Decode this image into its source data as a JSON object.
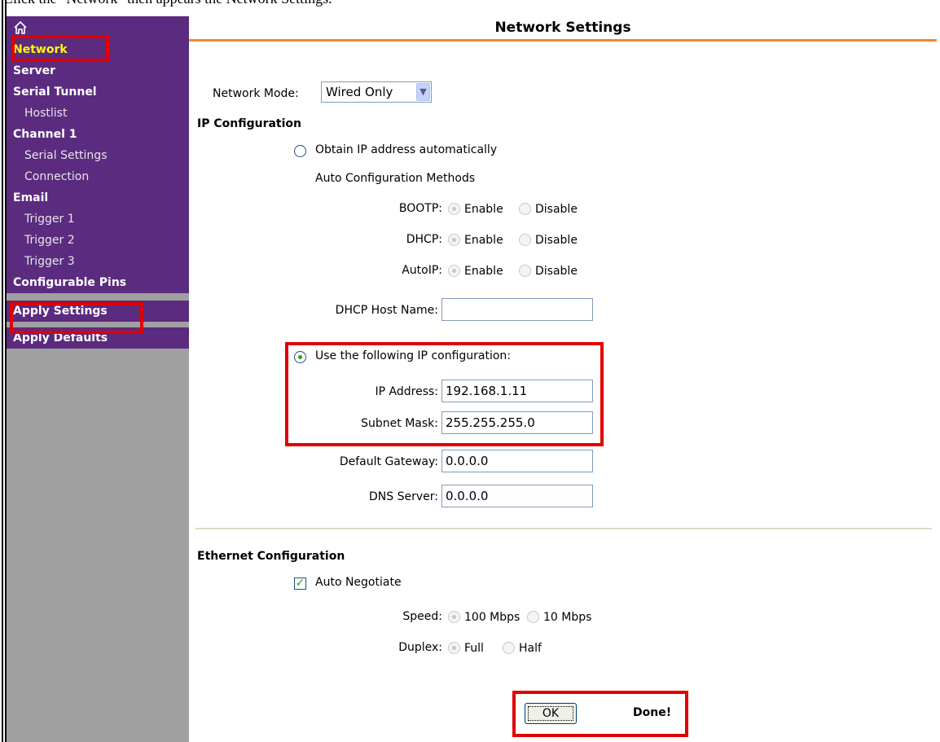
{
  "caption": "Click the \"Network\" then appears the Network Settings.",
  "sidebar": {
    "home_icon": "home-icon",
    "items": {
      "network": "Network",
      "server": "Server",
      "serial_tunnel": "Serial Tunnel",
      "hostlist": "Hostlist",
      "channel1": "Channel 1",
      "serial_settings": "Serial Settings",
      "connection": "Connection",
      "email": "Email",
      "trigger1": "Trigger 1",
      "trigger2": "Trigger 2",
      "trigger3": "Trigger 3",
      "configurable_pins": "Configurable Pins",
      "apply_settings": "Apply Settings",
      "apply_defaults": "Apply Defaults"
    }
  },
  "main": {
    "title": "Network Settings",
    "network_mode_label": "Network Mode:",
    "network_mode_value": "Wired Only",
    "ip_config_heading": "IP Configuration",
    "obtain_auto_label": "Obtain IP address automatically",
    "auto_methods_label": "Auto Configuration Methods",
    "bootp_label": "BOOTP:",
    "dhcp_label": "DHCP:",
    "autoip_label": "AutoIP:",
    "enable_label": "Enable",
    "disable_label": "Disable",
    "dhcp_host_label": "DHCP Host Name:",
    "dhcp_host_value": "",
    "use_following_label": "Use the following IP configuration:",
    "ip_address_label": "IP Address:",
    "ip_address_value": "192.168.1.11",
    "subnet_label": "Subnet Mask:",
    "subnet_value": "255.255.255.0",
    "gateway_label": "Default Gateway:",
    "gateway_value": "0.0.0.0",
    "dns_label": "DNS Server:",
    "dns_value": "0.0.0.0",
    "ethernet_heading": "Ethernet Configuration",
    "auto_negotiate_label": "Auto Negotiate",
    "speed_label": "Speed:",
    "speed_100": "100 Mbps",
    "speed_10": "10 Mbps",
    "duplex_label": "Duplex:",
    "duplex_full": "Full",
    "duplex_half": "Half",
    "ok_label": "OK",
    "done_label": "Done!"
  },
  "colors": {
    "sidebar_purple": "#5b2b80",
    "active_item": "#ffff00",
    "title_rule": "#f18a2f",
    "highlight_red": "#e00000"
  }
}
